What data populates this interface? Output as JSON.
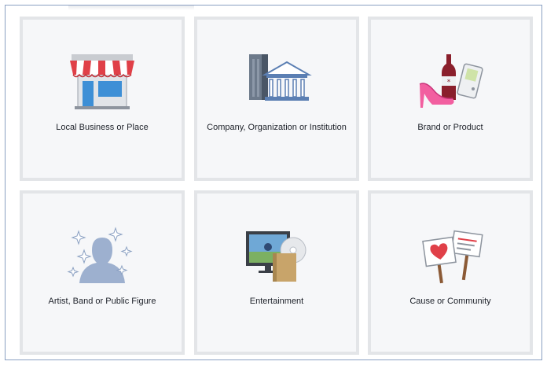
{
  "categories": [
    {
      "label": "Local Business or Place",
      "icon": "storefront-icon"
    },
    {
      "label": "Company, Organization or Institution",
      "icon": "office-building-icon"
    },
    {
      "label": "Brand or Product",
      "icon": "products-icon"
    },
    {
      "label": "Artist, Band or Public Figure",
      "icon": "person-silhouette-icon"
    },
    {
      "label": "Entertainment",
      "icon": "tv-and-disc-icon"
    },
    {
      "label": "Cause or Community",
      "icon": "protest-signs-icon"
    }
  ],
  "colors": {
    "tile_background": "#f6f7f9",
    "tile_border": "#e3e5e8",
    "frame_border": "#8aa0c2",
    "label_text": "#1d2129"
  }
}
